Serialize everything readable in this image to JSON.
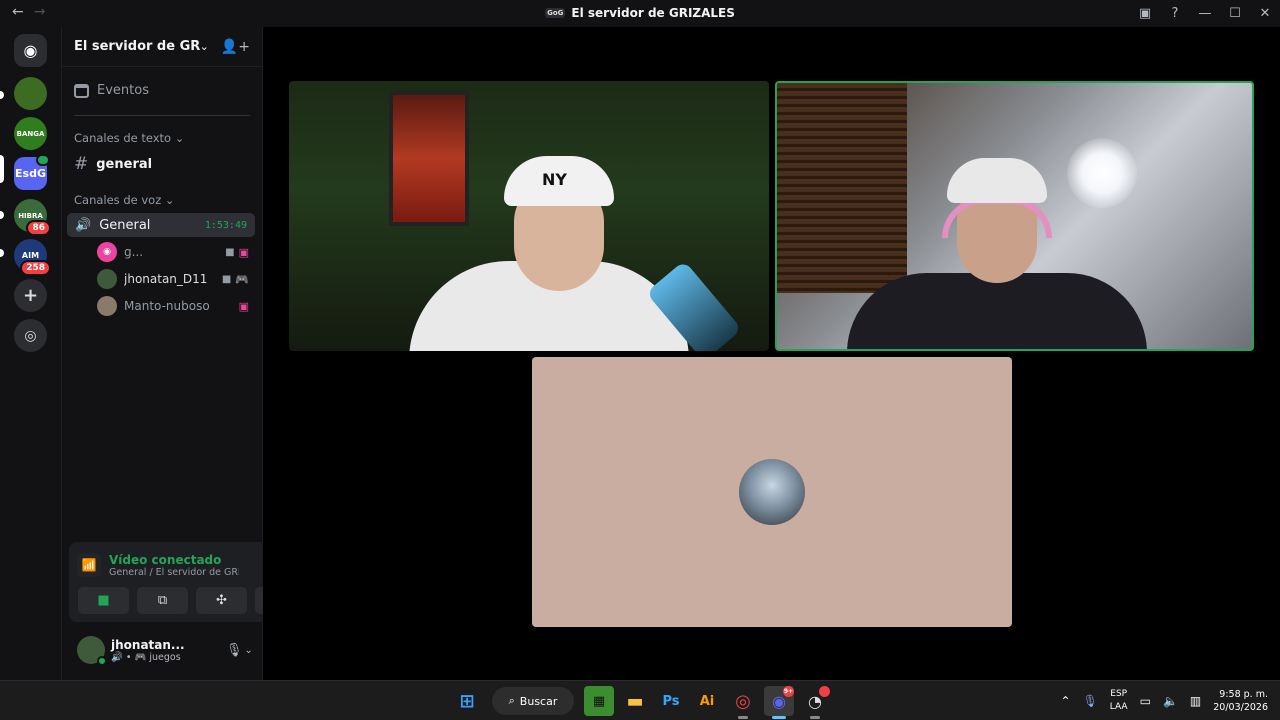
{
  "window": {
    "title": "El servidor de GRIZALES",
    "server_mini": "GoG",
    "back_glyph": "←",
    "forward_glyph": "→"
  },
  "rail": {
    "servers": [
      {
        "label": "",
        "badge": "",
        "color": "#3c6b22"
      },
      {
        "label": "BANGA",
        "badge": "",
        "color": "#2f7d1c"
      },
      {
        "label": "EsdG",
        "badge": "",
        "color": "#5865f2",
        "active": true
      },
      {
        "label": "HIBRA",
        "badge": "86",
        "color": "#3a6b3a"
      },
      {
        "label": "AIM",
        "badge": "258",
        "color": "#1e3a7a"
      }
    ]
  },
  "sidebar": {
    "server_name": "El servidor de GRIZA...",
    "events_label": "Eventos",
    "text_category": "Canales de texto",
    "text_channel": "general",
    "voice_category": "Canales de voz",
    "voice_channel": "General",
    "voice_timer": "1:53:49",
    "members": [
      {
        "name": "g...",
        "avatar_color": "#eb459f",
        "bright": false
      },
      {
        "name": "jhonatan_D11",
        "avatar_color": "#3f5a3a",
        "bright": true
      },
      {
        "name": "Manto-nuboso",
        "avatar_color": "#8a7a6a",
        "bright": false
      }
    ]
  },
  "voice_panel": {
    "status": "Vídeo conectado",
    "location": "General / El servidor de GRI..."
  },
  "user": {
    "name": "jhonatan...",
    "activity": "juegos"
  },
  "stage": {
    "tiles": [
      "tile-streamer-1",
      "tile-streamer-2",
      "tile-audio-only"
    ]
  },
  "taskbar": {
    "search_label": "Buscar",
    "discord_badge": "9+",
    "lang_top": "ESP",
    "lang_bottom": "LAA",
    "time": "9:58 p. m.",
    "date": "20/03/2026"
  },
  "colors": {
    "accent_green": "#23a559",
    "blurple": "#5865f2",
    "audio_tile_bg": "#c8ada0"
  }
}
